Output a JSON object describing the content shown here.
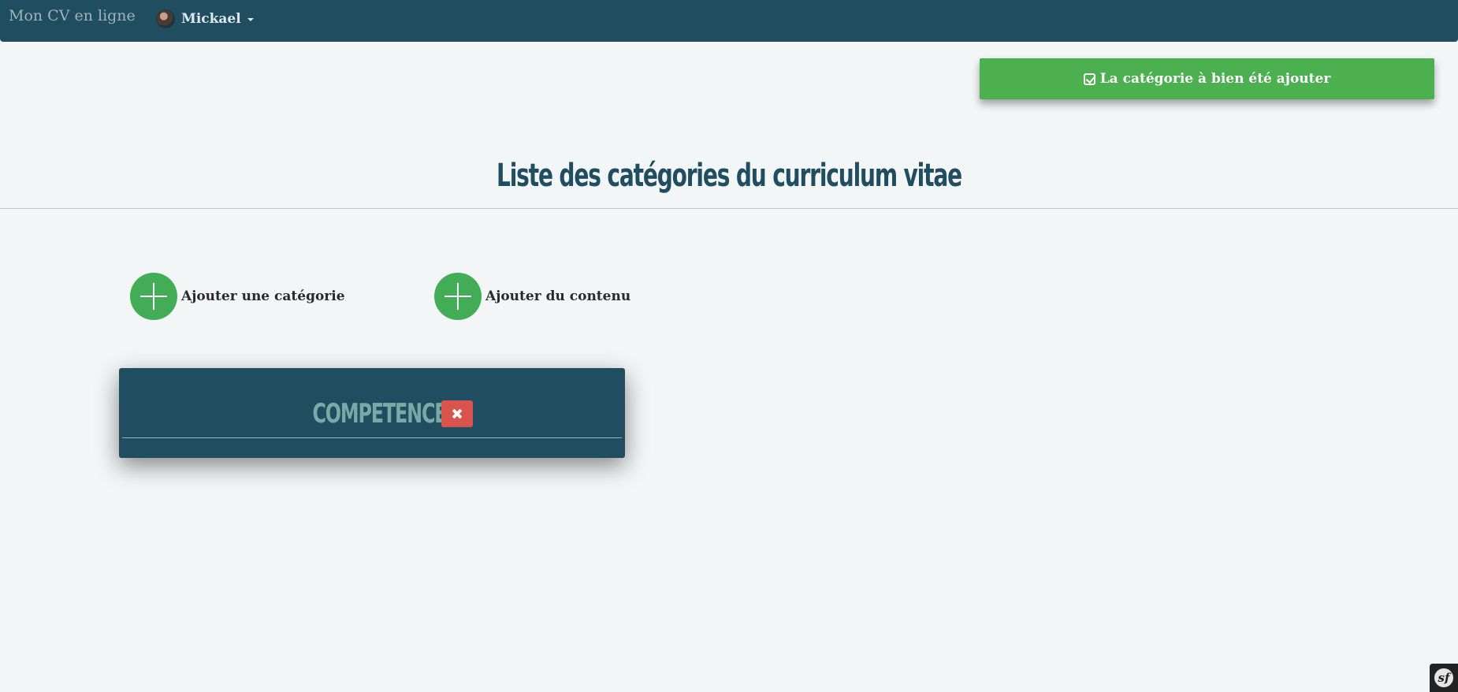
{
  "navbar": {
    "brand": "Mon CV en ligne",
    "user_name": "Mickael"
  },
  "alert": {
    "message": "La catégorie à bien été ajouter",
    "icon": "check-square-icon",
    "color": "#4caf50"
  },
  "page": {
    "title": "Liste des catégories du curriculum vitae"
  },
  "actions": [
    {
      "label": "Ajouter une catégorie",
      "icon": "plus-circle-icon"
    },
    {
      "label": "Ajouter du contenu",
      "icon": "plus-circle-icon"
    }
  ],
  "categories": [
    {
      "name": "COMPETENCES",
      "delete_icon": "close-icon"
    }
  ],
  "toolbar": {
    "logo_text": "sf"
  },
  "colors": {
    "primary": "#204d60",
    "success": "#43ac57",
    "danger": "#d9534f",
    "background": "#f2f6f7"
  }
}
